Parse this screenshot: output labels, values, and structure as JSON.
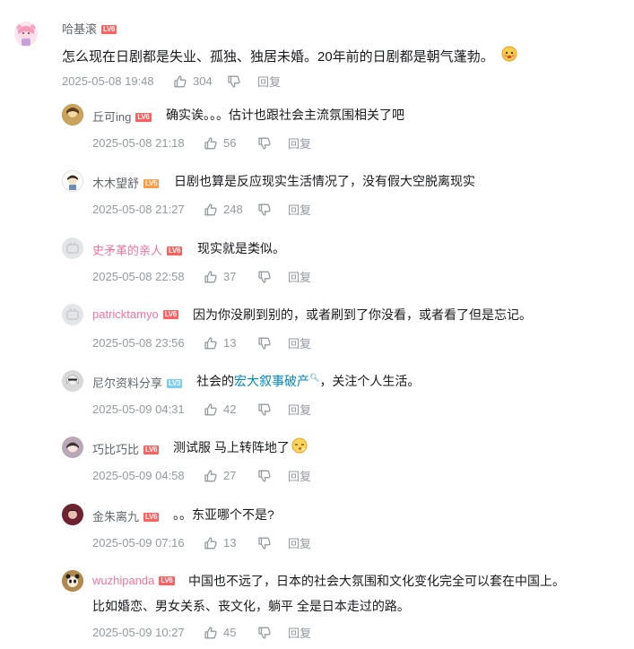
{
  "main_comment": {
    "username": "哈基滚",
    "level": "LV6",
    "text": "怎么现在日剧都是失业、孤独、独居未婚。20年前的日剧都是朝气蓬勃。",
    "time": "2025-05-08 19:48",
    "likes": "304",
    "reply_label": "回复"
  },
  "replies": [
    {
      "username": "丘可ing",
      "level": "LV6",
      "text": "确实诶。。。估计也跟社会主流氛围相关了吧",
      "time": "2025-05-08 21:18",
      "likes": "56",
      "reply_label": "回复"
    },
    {
      "username": "木木望舒",
      "level": "LV5",
      "text": "日剧也算是反应现实生活情况了，没有假大空脱离现实",
      "time": "2025-05-08 21:27",
      "likes": "248",
      "reply_label": "回复"
    },
    {
      "username": "史矛革的亲人",
      "level": "LV6",
      "text": "现实就是类似。",
      "time": "2025-05-08 22:58",
      "likes": "37",
      "reply_label": "回复"
    },
    {
      "username": "patricktamyo",
      "level": "LV6",
      "text": "因为你没刷到别的，或者刷到了你没看，或者看了但是忘记。",
      "time": "2025-05-08 23:56",
      "likes": "13",
      "reply_label": "回复"
    },
    {
      "username": "尼尔资料分享",
      "level": "LV3",
      "text_before": "社会的",
      "link": "宏大叙事破产",
      "text_after": "，关注个人生活。",
      "time": "2025-05-09 04:31",
      "likes": "42",
      "reply_label": "回复"
    },
    {
      "username": "巧比巧比",
      "level": "LV6",
      "text": "测试服 马上转阵地了",
      "time": "2025-05-09 04:58",
      "likes": "27",
      "reply_label": "回复"
    },
    {
      "username": "金朱离九",
      "level": "LV6",
      "text": "。。东亚哪个不是?",
      "time": "2025-05-09 07:16",
      "likes": "13",
      "reply_label": "回复"
    },
    {
      "username": "wuzhipanda",
      "level": "LV6",
      "text_line1": "中国也不远了，日本的社会大氛围和文化变化完全可以套在中国上。",
      "text_line2": "比如婚恋、男女关系、丧文化，躺平 全是日本走过的路。",
      "time": "2025-05-09 10:27",
      "likes": "45",
      "reply_label": "回复"
    }
  ],
  "colors": {
    "pink_name": "#fb7299",
    "link": "#008ac5",
    "meta": "#9499a0"
  }
}
